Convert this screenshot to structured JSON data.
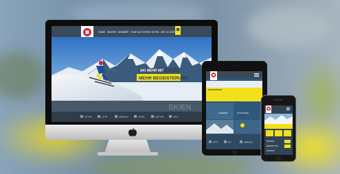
{
  "colors": {
    "brand_yellow": "#f2e01c",
    "header_slate": "#3d4d5c",
    "logo_red": "#d8232a",
    "tile_blue": "#2d5878",
    "monitor_black": "#0c0c0c",
    "monitor_silver": "#d8d8d8"
  },
  "desktop": {
    "nav": [
      "HOME",
      "WINTER",
      "SOMMER",
      "TOUR",
      "ACTIVITIES",
      "HOTEL",
      "ZEIT & KONTAKT"
    ],
    "hero_line1": "SKI MEHR MIT",
    "hero_line2": "MEHR BEGEISTERUNG",
    "watermark": "SKIEN",
    "footer_labels": [
      "ACTIVE",
      "LIFTE",
      "WEBCAM",
      "HOTEL",
      "WETTER",
      "INFO"
    ],
    "slider_prev_icon": "chevron-left-icon",
    "slider_next_icon": "chevron-right-icon",
    "stand_logo_icon": "apple-logo-icon"
  },
  "tablet": {
    "tiles": [
      "SKIGEBIET",
      "ACTIVE PARK"
    ],
    "footer_labels": [
      "LIFTE",
      "SKI",
      "WEBCAM"
    ]
  },
  "phone": {
    "menu": [
      "PROJEKT",
      "WINTER TIPS",
      "KONTAKT"
    ]
  }
}
